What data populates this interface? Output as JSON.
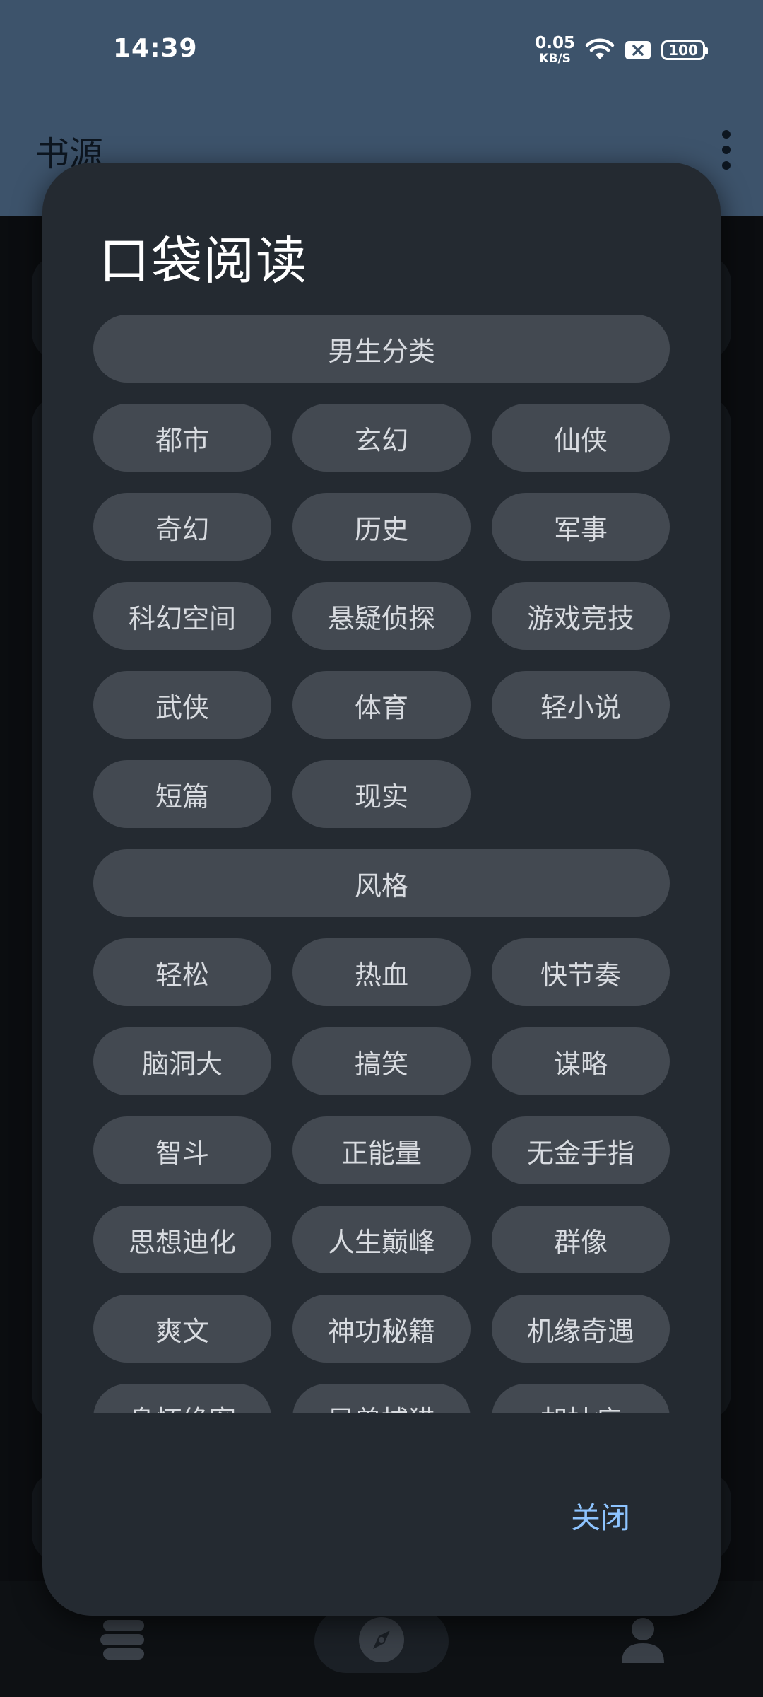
{
  "status_bar": {
    "time": "14:39",
    "net_speed_value": "0.05",
    "net_speed_unit": "KB/S",
    "battery": "100",
    "wifi_icon": "wifi-icon",
    "sim_icon": "no-sim-icon"
  },
  "app_bar": {
    "title": "书源",
    "more_icon": "more-vertical-icon"
  },
  "dialog": {
    "title": "口袋阅读",
    "sections": [
      {
        "heading": "男生分类",
        "chips": [
          "都市",
          "玄幻",
          "仙侠",
          "奇幻",
          "历史",
          "军事",
          "科幻空间",
          "悬疑侦探",
          "游戏竞技",
          "武侠",
          "体育",
          "轻小说",
          "短篇",
          "现实"
        ]
      },
      {
        "heading": "风格",
        "chips": [
          "轻松",
          "热血",
          "快节奏",
          "脑洞大",
          "搞笑",
          "谋略",
          "智斗",
          "正能量",
          "无金手指",
          "思想迪化",
          "人生巅峰",
          "群像",
          "爽文",
          "神功秘籍",
          "机缘奇遇",
          "身怀绝密",
          "异兽捕猎",
          "胡扯症"
        ]
      }
    ],
    "close_label": "关闭"
  },
  "bottom_nav": {
    "items": [
      {
        "icon": "bookshelf-icon"
      },
      {
        "icon": "compass-icon"
      },
      {
        "icon": "person-icon"
      }
    ]
  },
  "colors": {
    "app_bar": "#3d536b",
    "dialog_bg": "#242a31",
    "chip_bg": "#434951",
    "accent": "#8ec4ff"
  }
}
